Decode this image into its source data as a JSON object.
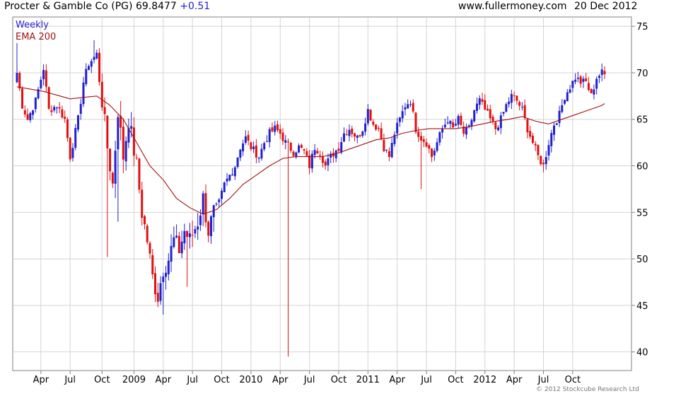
{
  "header": {
    "title": "Procter & Gamble Co (PG) 69.8477",
    "change": "+0.51",
    "site": "www.fullermoney.com",
    "date": "20 Dec 2012"
  },
  "footer": {
    "copyright": "© 2012 Stockcube Research Ltd"
  },
  "colors": {
    "up": "#2020d0",
    "down": "#e01010",
    "ema": "#a01010",
    "grid": "#d4d4d4",
    "border": "#808080"
  },
  "chart_data": {
    "type": "candlestick",
    "legend": [
      "Weekly",
      "EMA 200"
    ],
    "ylim": [
      38,
      76
    ],
    "yticks": [
      40,
      45,
      50,
      55,
      60,
      65,
      70,
      75
    ],
    "xlim": [
      0,
      229
    ],
    "xticks": [
      {
        "w": 9,
        "label": "Apr"
      },
      {
        "w": 20,
        "label": "Jul"
      },
      {
        "w": 32,
        "label": "Oct"
      },
      {
        "w": 44,
        "label": "2009"
      },
      {
        "w": 55,
        "label": "Apr"
      },
      {
        "w": 66,
        "label": "Jul"
      },
      {
        "w": 77,
        "label": "Oct"
      },
      {
        "w": 88,
        "label": "2010"
      },
      {
        "w": 99,
        "label": "Apr"
      },
      {
        "w": 110,
        "label": "Jul"
      },
      {
        "w": 121,
        "label": "Oct"
      },
      {
        "w": 132,
        "label": "2011"
      },
      {
        "w": 143,
        "label": "Apr"
      },
      {
        "w": 154,
        "label": "Jul"
      },
      {
        "w": 165,
        "label": "Oct"
      },
      {
        "w": 176,
        "label": "2012"
      },
      {
        "w": 187,
        "label": "Apr"
      },
      {
        "w": 198,
        "label": "Jul"
      },
      {
        "w": 209,
        "label": "Oct"
      }
    ],
    "close_anchors": [
      [
        0,
        70
      ],
      [
        2,
        66.5
      ],
      [
        4,
        65
      ],
      [
        7,
        67
      ],
      [
        10,
        70.5
      ],
      [
        12,
        66
      ],
      [
        15,
        66.5
      ],
      [
        18,
        65
      ],
      [
        20,
        61
      ],
      [
        23,
        65
      ],
      [
        25,
        69
      ],
      [
        27,
        71
      ],
      [
        30,
        72
      ],
      [
        32,
        67
      ],
      [
        34,
        62
      ],
      [
        36,
        58
      ],
      [
        38,
        66
      ],
      [
        40,
        61
      ],
      [
        42,
        65
      ],
      [
        45,
        60
      ],
      [
        47,
        55
      ],
      [
        49,
        52
      ],
      [
        51,
        48
      ],
      [
        53,
        46
      ],
      [
        55,
        49
      ],
      [
        57,
        50
      ],
      [
        59,
        52
      ],
      [
        61,
        51
      ],
      [
        63,
        53
      ],
      [
        65,
        52
      ],
      [
        68,
        54
      ],
      [
        70,
        56.5
      ],
      [
        72,
        53
      ],
      [
        74,
        55
      ],
      [
        76,
        56
      ],
      [
        78,
        58
      ],
      [
        80,
        59
      ],
      [
        82,
        60
      ],
      [
        84,
        62
      ],
      [
        86,
        63
      ],
      [
        88,
        62
      ],
      [
        91,
        61
      ],
      [
        93,
        62.5
      ],
      [
        95,
        63.5
      ],
      [
        97,
        64
      ],
      [
        99,
        63.5
      ],
      [
        101,
        62.5
      ],
      [
        104,
        61.5
      ],
      [
        106,
        62
      ],
      [
        108,
        61.5
      ],
      [
        110,
        60
      ],
      [
        112,
        62
      ],
      [
        114,
        61.5
      ],
      [
        116,
        60
      ],
      [
        118,
        61
      ],
      [
        121,
        62
      ],
      [
        123,
        63.5
      ],
      [
        125,
        64
      ],
      [
        128,
        63
      ],
      [
        130,
        64
      ],
      [
        132,
        66
      ],
      [
        134,
        64.5
      ],
      [
        136,
        64
      ],
      [
        138,
        62
      ],
      [
        140,
        61
      ],
      [
        142,
        63.5
      ],
      [
        144,
        65
      ],
      [
        146,
        66.5
      ],
      [
        148,
        67
      ],
      [
        150,
        64
      ],
      [
        152,
        63
      ],
      [
        154,
        62.5
      ],
      [
        156,
        61
      ],
      [
        158,
        62.5
      ],
      [
        160,
        64
      ],
      [
        162,
        65
      ],
      [
        164,
        64
      ],
      [
        166,
        65
      ],
      [
        168,
        63.5
      ],
      [
        170,
        64
      ],
      [
        172,
        66
      ],
      [
        174,
        67
      ],
      [
        176,
        66
      ],
      [
        178,
        65
      ],
      [
        180,
        64
      ],
      [
        182,
        65
      ],
      [
        184,
        66.5
      ],
      [
        186,
        67.5
      ],
      [
        188,
        67
      ],
      [
        190,
        66
      ],
      [
        192,
        64
      ],
      [
        194,
        62.5
      ],
      [
        196,
        61
      ],
      [
        198,
        60
      ],
      [
        200,
        62.5
      ],
      [
        202,
        64.5
      ],
      [
        204,
        65.5
      ],
      [
        206,
        67.5
      ],
      [
        208,
        68.5
      ],
      [
        210,
        69.5
      ],
      [
        212,
        69
      ],
      [
        214,
        69
      ],
      [
        216,
        67.5
      ],
      [
        218,
        69.5
      ],
      [
        220,
        70
      ],
      [
        221,
        69.8477
      ]
    ],
    "ema_points": [
      [
        0,
        68.5
      ],
      [
        10,
        68
      ],
      [
        20,
        67.2
      ],
      [
        30,
        67.5
      ],
      [
        35,
        66.5
      ],
      [
        40,
        65
      ],
      [
        45,
        62.5
      ],
      [
        50,
        60
      ],
      [
        55,
        58.5
      ],
      [
        60,
        56.5
      ],
      [
        65,
        55.5
      ],
      [
        70,
        54.8
      ],
      [
        75,
        55.3
      ],
      [
        80,
        56.5
      ],
      [
        85,
        58
      ],
      [
        90,
        59
      ],
      [
        95,
        60
      ],
      [
        100,
        60.8
      ],
      [
        105,
        61
      ],
      [
        110,
        61
      ],
      [
        115,
        61
      ],
      [
        120,
        61.3
      ],
      [
        125,
        61.8
      ],
      [
        130,
        62.3
      ],
      [
        135,
        62.8
      ],
      [
        140,
        63
      ],
      [
        145,
        63.5
      ],
      [
        150,
        63.8
      ],
      [
        155,
        64
      ],
      [
        160,
        64
      ],
      [
        165,
        64
      ],
      [
        170,
        64.2
      ],
      [
        175,
        64.5
      ],
      [
        180,
        64.8
      ],
      [
        185,
        65
      ],
      [
        190,
        65.3
      ],
      [
        195,
        64.8
      ],
      [
        200,
        64.5
      ],
      [
        205,
        65
      ],
      [
        210,
        65.5
      ],
      [
        215,
        66
      ],
      [
        220,
        66.5
      ],
      [
        221,
        66.7
      ]
    ],
    "special_wicks": [
      {
        "w": 34,
        "low": 50.2
      },
      {
        "w": 38,
        "low": 54
      },
      {
        "w": 55,
        "low": 44
      },
      {
        "w": 64,
        "low": 47
      },
      {
        "w": 102,
        "low": 39.5
      },
      {
        "w": 152,
        "low": 57.5
      },
      {
        "w": 198,
        "low": 59.3
      },
      {
        "w": 29,
        "high": 73.5
      },
      {
        "w": 0,
        "high": 73.2
      }
    ]
  }
}
